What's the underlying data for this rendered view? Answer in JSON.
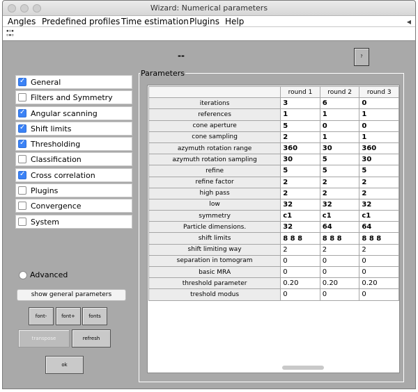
{
  "window": {
    "title": "Wizard: Numerical parameters"
  },
  "menu": [
    "Angles",
    "Predefined profiles",
    "Time estimation",
    "Plugins",
    "Help"
  ],
  "status_text": "--",
  "help_button_label": "?",
  "categories": [
    {
      "label": "General",
      "checked": true
    },
    {
      "label": "Filters and Symmetry",
      "checked": false
    },
    {
      "label": "Angular scanning",
      "checked": true
    },
    {
      "label": "Shift limits",
      "checked": true
    },
    {
      "label": "Thresholding",
      "checked": true
    },
    {
      "label": "Classification",
      "checked": false
    },
    {
      "label": "Cross correlation",
      "checked": true
    },
    {
      "label": "Plugins",
      "checked": false
    },
    {
      "label": "Convergence",
      "checked": false
    },
    {
      "label": "System",
      "checked": false
    }
  ],
  "advanced_label": "Advanced",
  "buttons": {
    "show_general": "show general parameters",
    "font_minus": "font-",
    "font_plus": "font+",
    "fonts": "fonts",
    "transpose": "transpose",
    "refresh": "refresh",
    "ok": "ok"
  },
  "parameters_title": "Parameters",
  "table": {
    "columns": [
      "round 1",
      "round 2",
      "round 3"
    ],
    "rows": [
      {
        "name": "iterations",
        "values": [
          "3",
          "6",
          "0"
        ]
      },
      {
        "name": "references",
        "values": [
          "1",
          "1",
          "1"
        ]
      },
      {
        "name": "cone aperture",
        "values": [
          "5",
          "0",
          "0"
        ]
      },
      {
        "name": "cone sampling",
        "values": [
          "2",
          "1",
          "1"
        ]
      },
      {
        "name": "azymuth rotation range",
        "values": [
          "360",
          "30",
          "360"
        ]
      },
      {
        "name": "azymuth rotation sampling",
        "values": [
          "30",
          "5",
          "30"
        ]
      },
      {
        "name": "refine",
        "values": [
          "5",
          "5",
          "5"
        ]
      },
      {
        "name": "refine factor",
        "values": [
          "2",
          "2",
          "2"
        ]
      },
      {
        "name": "high pass",
        "values": [
          "2",
          "2",
          "2"
        ]
      },
      {
        "name": "low",
        "values": [
          "32",
          "32",
          "32"
        ]
      },
      {
        "name": "symmetry",
        "values": [
          "c1",
          "c1",
          "c1"
        ]
      },
      {
        "name": "Particle dimensions.",
        "values": [
          "32",
          "64",
          "64"
        ]
      },
      {
        "name": "shift limits",
        "values": [
          "8 8 8",
          "8 8 8",
          "8 8 8"
        ]
      },
      {
        "name": "shift limiting way",
        "values": [
          "2",
          "2",
          "2"
        ]
      },
      {
        "name": "separation in tomogram",
        "values": [
          "0",
          "0",
          "0"
        ]
      },
      {
        "name": "basic MRA",
        "values": [
          "0",
          "0",
          "0"
        ]
      },
      {
        "name": "threshold parameter",
        "values": [
          "0.20",
          "0.20",
          "0.20"
        ]
      },
      {
        "name": "treshold modus",
        "values": [
          "0",
          "0",
          "0"
        ]
      }
    ]
  }
}
